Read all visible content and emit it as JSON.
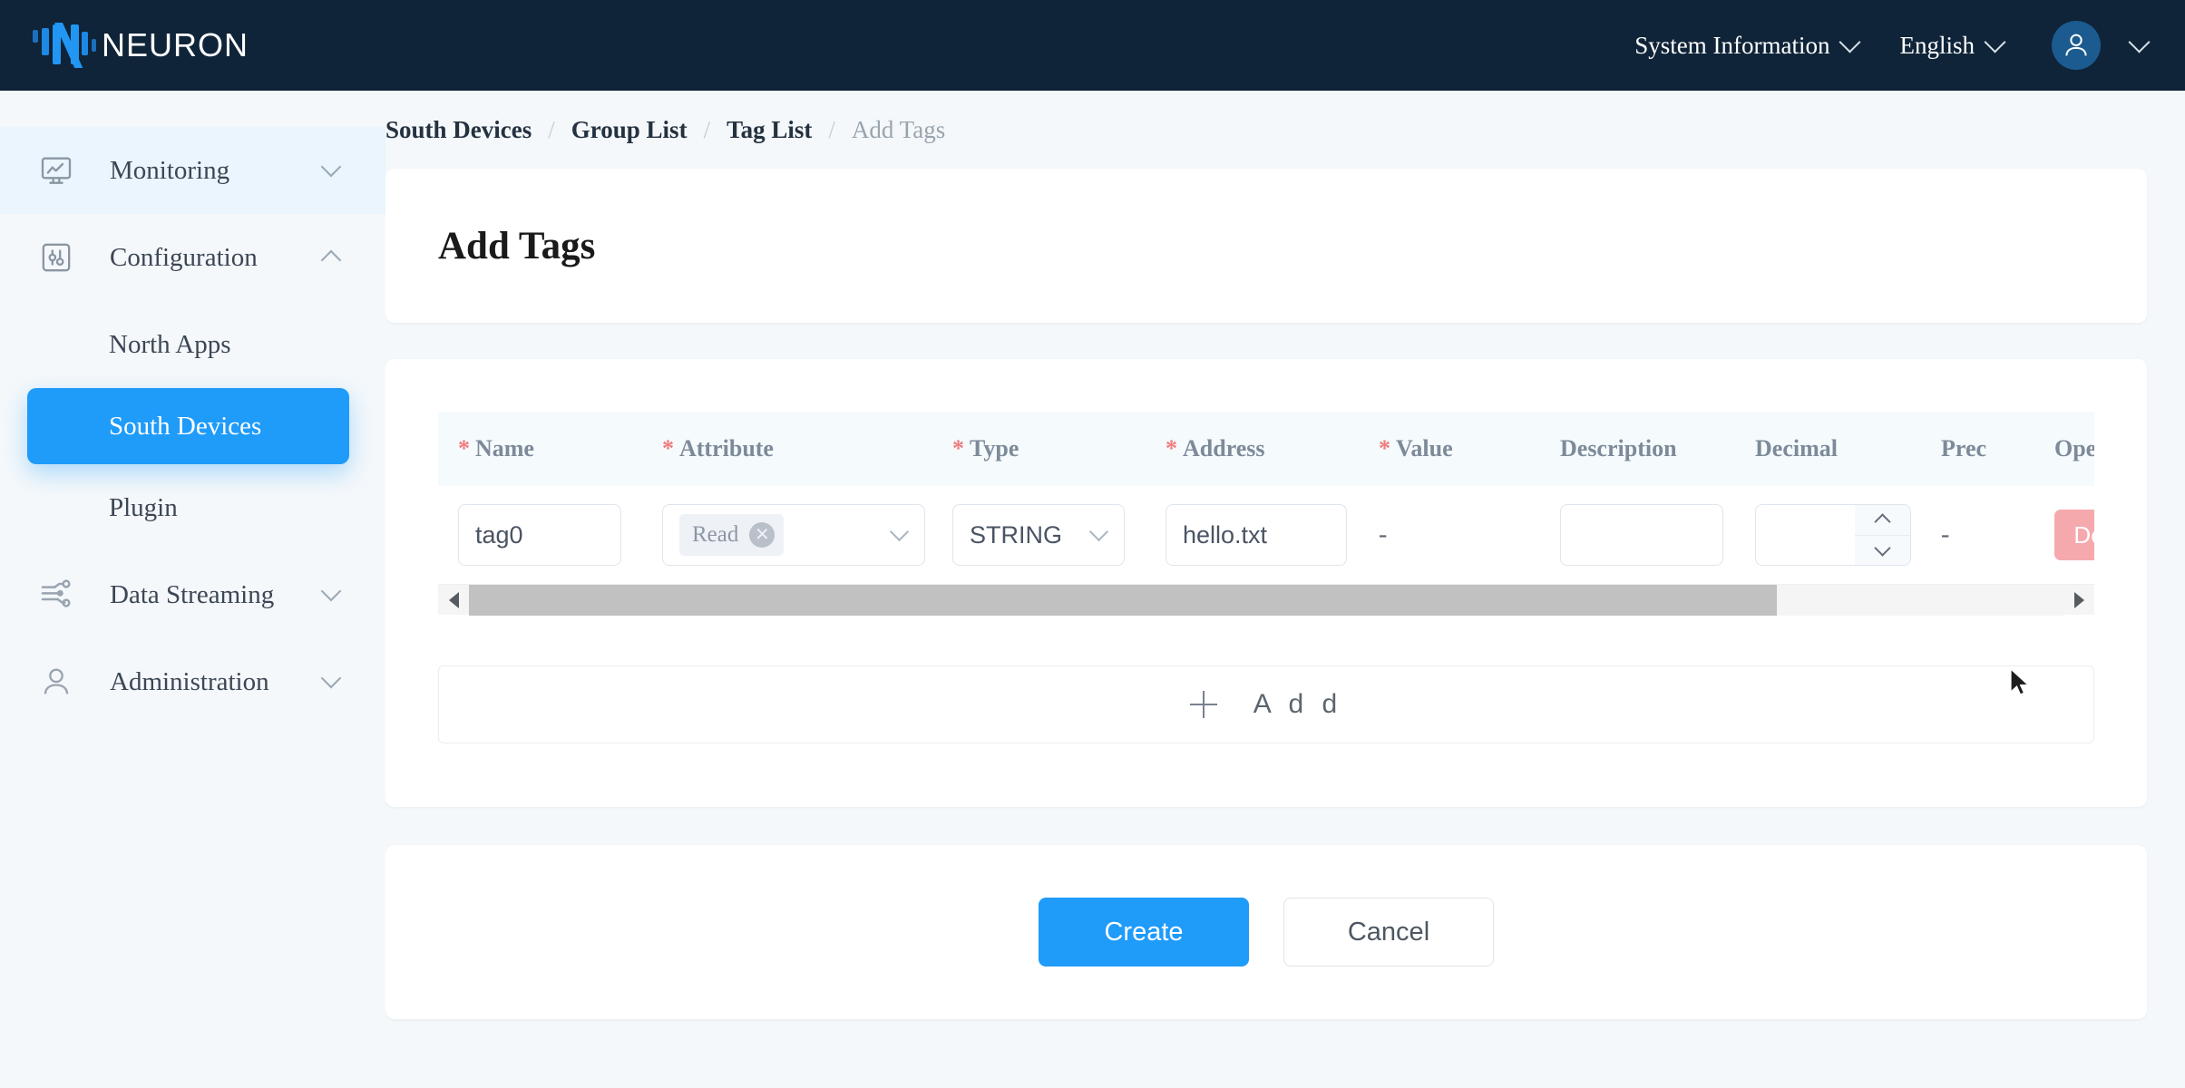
{
  "header": {
    "brand": "NEURON",
    "system_info_label": "System Information",
    "language_label": "English"
  },
  "sidebar": {
    "groups": [
      {
        "label": "Monitoring",
        "icon": "monitor-chart-icon",
        "expanded": false,
        "highlighted": true
      },
      {
        "label": "Configuration",
        "icon": "sliders-icon",
        "expanded": true,
        "highlighted": false
      },
      {
        "label": "Data Streaming",
        "icon": "circuit-icon",
        "expanded": false,
        "highlighted": false
      },
      {
        "label": "Administration",
        "icon": "user-icon",
        "expanded": false,
        "highlighted": false
      }
    ],
    "config_children": [
      {
        "label": "North Apps",
        "active": false
      },
      {
        "label": "South Devices",
        "active": true
      },
      {
        "label": "Plugin",
        "active": false
      }
    ]
  },
  "breadcrumb": {
    "items": [
      {
        "label": "South Devices",
        "current": false
      },
      {
        "label": "Group List",
        "current": false
      },
      {
        "label": "Tag List",
        "current": false
      },
      {
        "label": "Add Tags",
        "current": true
      }
    ],
    "separator": "/"
  },
  "page": {
    "title": "Add Tags"
  },
  "table": {
    "columns": [
      {
        "key": "name",
        "label": "Name",
        "required": true
      },
      {
        "key": "attribute",
        "label": "Attribute",
        "required": true
      },
      {
        "key": "type",
        "label": "Type",
        "required": true
      },
      {
        "key": "address",
        "label": "Address",
        "required": true
      },
      {
        "key": "value",
        "label": "Value",
        "required": true
      },
      {
        "key": "description",
        "label": "Description",
        "required": false
      },
      {
        "key": "decimal",
        "label": "Decimal",
        "required": false
      },
      {
        "key": "precision",
        "label": "Prec",
        "required": false
      },
      {
        "key": "operate",
        "label": "Operate",
        "required": false
      }
    ],
    "rows": [
      {
        "name": "tag0",
        "attribute_chips": [
          "Read"
        ],
        "type": "STRING",
        "address": "hello.txt",
        "value": "-",
        "description": "",
        "decimal": "",
        "precision": "-",
        "delete_label": "Delete"
      }
    ],
    "add_row_label": "A d d",
    "scroll_thumb_percent": 82
  },
  "actions": {
    "create_label": "Create",
    "cancel_label": "Cancel"
  },
  "colors": {
    "topbar": "#0f2438",
    "accent": "#1f9bfa",
    "page_bg": "#f4f8fb",
    "required_star": "#ee7b7b",
    "delete_btn": "#f6a9ad"
  }
}
